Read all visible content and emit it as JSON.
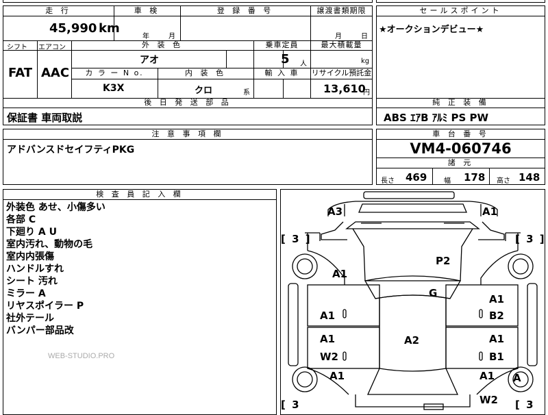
{
  "header_top": {
    "mileage_label": "走 行",
    "inspection_label": "車 検",
    "registration_label": "登 録 番 号",
    "transfer_deadline_label": "譲渡書類期限",
    "mileage_value": "45,990",
    "mileage_unit": "km",
    "inspection_year": "年",
    "inspection_month": "月",
    "transfer_month": "月",
    "transfer_day": "日"
  },
  "sales_point": {
    "label": "セールスポイント",
    "text": "★オークションデビュー★"
  },
  "specs": {
    "shift_label": "シフト",
    "aircon_label": "エアコン",
    "exterior_color_label": "外 装 色",
    "capacity_label": "乗車定員",
    "max_load_label": "最大積載量",
    "shift_value": "FAT",
    "aircon_value": "AAC",
    "exterior_color_value": "アオ",
    "capacity_value": "5",
    "capacity_unit": "人",
    "max_load_unit": "kg",
    "color_no_label": "カ ラ ー N o.",
    "interior_color_label": "内 装 色",
    "import_label": "輸 入 車",
    "recycle_label": "リサイクル預託金",
    "color_no_value": "K3X",
    "interior_color_value": "クロ",
    "interior_suffix": "系",
    "recycle_value": "13,610",
    "recycle_unit": "円"
  },
  "later_parts": {
    "label": "後 日 発 送 部 品",
    "text": "保証書 車両取説"
  },
  "equipment": {
    "label": "純 正 装 備",
    "text": "ABS ｴｱB ｱﾙﾐ PS PW"
  },
  "notes": {
    "label": "注 意 事 項 欄",
    "text": "アドバンスドセイフティPKG"
  },
  "chassis": {
    "label": "車 台 番 号",
    "value": "VM4-060746"
  },
  "dimensions": {
    "label": "諸 元",
    "length_label": "長さ",
    "length_value": "469",
    "width_label": "幅",
    "width_value": "178",
    "height_label": "高さ",
    "height_value": "148"
  },
  "inspector": {
    "label": "検 査 員 記 入 欄",
    "lines": [
      "外装色 あせ、小傷多い",
      "各部 C",
      "下廻り A U",
      "室内汚れ、動物の毛",
      "室内内張傷",
      "ハンドルすれ",
      "シート 汚れ",
      "ミラー A",
      "リヤスポイラー P",
      "社外テール",
      "バンパー部品改"
    ],
    "watermark": "WEB-STUDIO.PRO"
  },
  "diagram": {
    "marks": {
      "front_left": "A3",
      "front_right": "A1",
      "bracket_left": "[ 3 ]",
      "bracket_right": "[ 3 ]",
      "bracket_bottom_left": "[ 3",
      "bracket_bottom_right": "[ 3",
      "fender_left": "A1",
      "hood": "P2",
      "windshield": "G",
      "front_door_left": "A1",
      "front_door_right_top": "A1",
      "front_door_right_bottom": "B2",
      "roof": "A2",
      "rear_door_left_top": "A1",
      "rear_door_left_bottom": "W2",
      "rear_door_right_top": "A1",
      "rear_door_right_bottom": "B1",
      "rear_fender_left": "A1",
      "rear_fender_right": "A1",
      "rear_wheel_right": "A",
      "rear_right_bottom": "W2"
    }
  }
}
